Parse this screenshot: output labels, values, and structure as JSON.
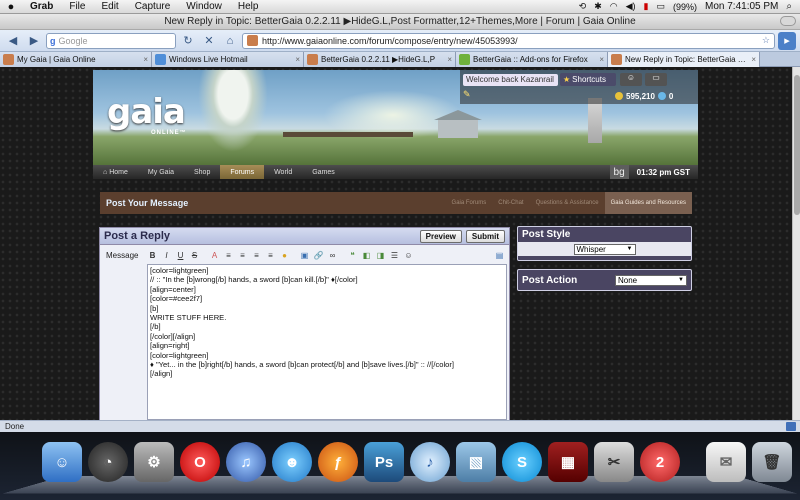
{
  "menubar": {
    "apple": "",
    "app": "Grab",
    "items": [
      "File",
      "Edit",
      "Capture",
      "Window",
      "Help"
    ],
    "battery": "(99%)",
    "clock": "Mon 7:41:05 PM"
  },
  "window": {
    "title": "New Reply in Topic: BetterGaia 0.2.2.11 ▶HideG.L,Post Formatter,12+Themes,More | Forum | Gaia Online"
  },
  "nav": {
    "search_placeholder": "Google",
    "url": "http://www.gaiaonline.com/forum/compose/entry/new/45053993/"
  },
  "tabs": [
    {
      "label": "My Gaia | Gaia Online",
      "close": "×"
    },
    {
      "label": "Windows Live Hotmail",
      "close": "×"
    },
    {
      "label": "BetterGaia 0.2.2.11 ▶HideG.L,P",
      "close": "×"
    },
    {
      "label": "BetterGaia :: Add-ons for Firefox",
      "close": "×"
    },
    {
      "label": "New Reply in Topic: BetterGaia 0.2...",
      "close": "×"
    }
  ],
  "banner": {
    "logo": "gaia",
    "logo_sub": "ONLINE™",
    "welcome": "Welcome back Kazanrail",
    "shortcuts": "Shortcuts",
    "gold": "595,210",
    "cash": "0"
  },
  "gaia_nav": {
    "items": [
      "Home",
      "My Gaia",
      "Shop",
      "Forums",
      "World",
      "Games"
    ],
    "active": "Forums",
    "bg": "bg",
    "clock": "01:32 pm GST"
  },
  "post_bar": {
    "title": "Post Your Message",
    "links": [
      "Gaia Forums",
      "Chit-Chat",
      "Questions & Assistance",
      "Gaia Guides and Resources"
    ]
  },
  "reply": {
    "title": "Post a Reply",
    "preview": "Preview",
    "submit": "Submit",
    "message_label": "Message",
    "text": "[color=lightgreen]\n// :: \"In the [b]wrong[/b] hands, a sword [b]can kill.[/b]\" ♦[/color]\n[align=center]\n[color=#cee2f7]\n[b]\nWRITE STUFF HERE.\n[/b]\n[/color][/align]\n[align=right]\n[color=lightgreen]\n♦ \"Yet... in the [b]right[/b] hands, a sword [b]can protect[/b] and [b]save lives.[/b]\" :: //[/color]\n[/align]"
  },
  "post_style": {
    "title": "Post Style",
    "value": "Whisper"
  },
  "post_action": {
    "title": "Post Action",
    "value": "None"
  },
  "status": "Done",
  "dock": {
    "icons": [
      "finder-icon",
      "dashboard-icon",
      "system-preferences-icon",
      "opera-icon",
      "itunes-icon",
      "messenger-icon",
      "firefox-icon",
      "photoshop-icon",
      "music-icon",
      "preview-icon",
      "skype-icon",
      "photo-booth-icon",
      "grab-icon",
      "app-2-icon",
      "mail-icon",
      "trash-icon"
    ]
  }
}
